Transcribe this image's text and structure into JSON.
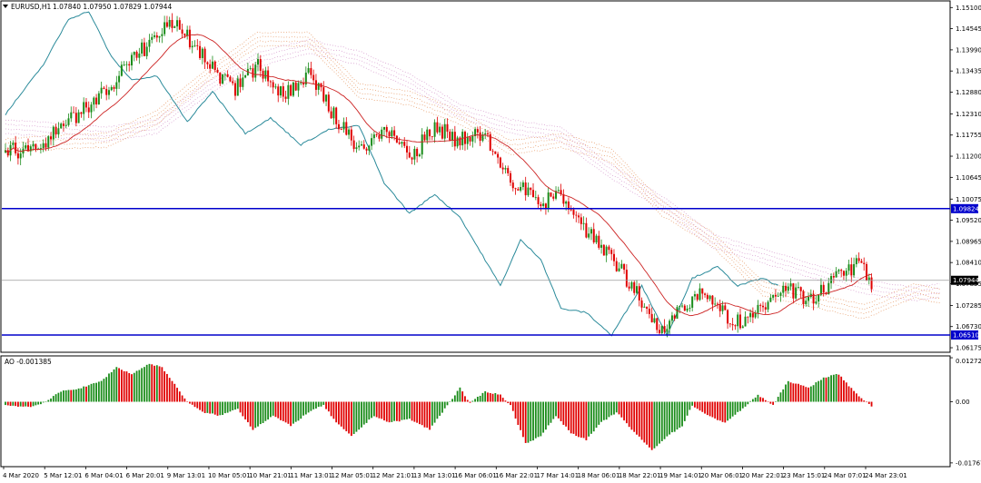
{
  "header": {
    "symbol_label": "EURUSD,H1",
    "ohlc": "1.07840 1.07950 1.07829 1.07944"
  },
  "oscillator": {
    "label": "AO -0.001385"
  },
  "colors": {
    "bull": "#1a8c1a",
    "bear": "#e00000",
    "level_line": "#0000cc",
    "ma": "#cc2222",
    "chikou": "#2a8a9a",
    "cloud_a": "#e8a070",
    "cloud_b": "#d8a0d0",
    "price_tag": "#000000"
  },
  "chart_data": [
    {
      "type": "candlestick",
      "panel": "main",
      "y_ticks": [
        "1.15100",
        "1.14545",
        "1.13990",
        "1.13435",
        "1.12880",
        "1.12310",
        "1.11755",
        "1.11200",
        "1.10645",
        "1.10075",
        "1.09520",
        "1.08965",
        "1.08410",
        "1.07855",
        "1.07285",
        "1.06730",
        "1.06175"
      ],
      "ylim": [
        1.0608,
        1.1525
      ],
      "x_ticks": [
        "4 Mar 2020",
        "5 Mar 12:01",
        "6 Mar 04:01",
        "6 Mar 20:01",
        "9 Mar 13:01",
        "10 Mar 05:01",
        "10 Mar 21:01",
        "11 Mar 13:01",
        "12 Mar 05:01",
        "12 Mar 21:01",
        "13 Mar 13:01",
        "16 Mar 06:01",
        "16 Mar 22:01",
        "17 Mar 14:01",
        "18 Mar 06:01",
        "18 Mar 22:01",
        "19 Mar 14:01",
        "20 Mar 06:01",
        "20 Mar 22:01",
        "23 Mar 15:01",
        "24 Mar 07:01",
        "24 Mar 23:01"
      ],
      "levels": [
        {
          "label": "1.09824",
          "value": 1.09824
        },
        {
          "label": "1.06510",
          "value": 1.0651
        }
      ],
      "current_price": {
        "label": "1.07944",
        "value": 1.07944
      },
      "close_anchors": [
        [
          0,
          1.113
        ],
        [
          12,
          1.1145
        ],
        [
          25,
          1.121
        ],
        [
          40,
          1.1295
        ],
        [
          50,
          1.137
        ],
        [
          58,
          1.1425
        ],
        [
          66,
          1.147
        ],
        [
          72,
          1.143
        ],
        [
          80,
          1.137
        ],
        [
          90,
          1.129
        ],
        [
          100,
          1.136
        ],
        [
          110,
          1.128
        ],
        [
          120,
          1.133
        ],
        [
          130,
          1.123
        ],
        [
          140,
          1.114
        ],
        [
          152,
          1.119
        ],
        [
          160,
          1.111
        ],
        [
          170,
          1.12
        ],
        [
          180,
          1.116
        ],
        [
          190,
          1.118
        ],
        [
          200,
          1.106
        ],
        [
          210,
          1.1
        ],
        [
          220,
          1.101
        ],
        [
          230,
          1.092
        ],
        [
          240,
          1.086
        ],
        [
          250,
          1.076
        ],
        [
          258,
          1.066
        ],
        [
          266,
          1.071
        ],
        [
          275,
          1.077
        ],
        [
          285,
          1.07
        ],
        [
          292,
          1.068
        ],
        [
          300,
          1.072
        ],
        [
          310,
          1.077
        ],
        [
          320,
          1.074
        ],
        [
          330,
          1.081
        ],
        [
          338,
          1.084
        ],
        [
          343,
          1.079
        ]
      ],
      "chikou_anchors": [
        [
          0,
          1.123
        ],
        [
          15,
          1.136
        ],
        [
          25,
          1.148
        ],
        [
          33,
          1.15
        ],
        [
          42,
          1.138
        ],
        [
          50,
          1.132
        ],
        [
          60,
          1.133
        ],
        [
          72,
          1.121
        ],
        [
          82,
          1.129
        ],
        [
          95,
          1.118
        ],
        [
          105,
          1.122
        ],
        [
          117,
          1.115
        ],
        [
          128,
          1.119
        ],
        [
          140,
          1.12
        ],
        [
          150,
          1.105
        ],
        [
          160,
          1.097
        ],
        [
          170,
          1.102
        ],
        [
          180,
          1.096
        ],
        [
          188,
          1.087
        ],
        [
          196,
          1.078
        ],
        [
          204,
          1.09
        ],
        [
          212,
          1.085
        ],
        [
          220,
          1.072
        ],
        [
          230,
          1.071
        ],
        [
          240,
          1.065
        ],
        [
          252,
          1.078
        ],
        [
          262,
          1.065
        ],
        [
          272,
          1.08
        ],
        [
          282,
          1.083
        ],
        [
          290,
          1.078
        ],
        [
          300,
          1.08
        ],
        [
          306,
          1.078
        ]
      ],
      "cloud_a_anchors": [
        [
          0,
          1.1165
        ],
        [
          20,
          1.1175
        ],
        [
          40,
          1.118
        ],
        [
          60,
          1.124
        ],
        [
          80,
          1.135
        ],
        [
          100,
          1.1445
        ],
        [
          120,
          1.1445
        ],
        [
          140,
          1.131
        ],
        [
          160,
          1.129
        ],
        [
          180,
          1.124
        ],
        [
          200,
          1.116
        ],
        [
          220,
          1.118
        ],
        [
          240,
          1.114
        ],
        [
          260,
          1.1
        ],
        [
          280,
          1.092
        ],
        [
          300,
          1.079
        ],
        [
          320,
          1.076
        ],
        [
          340,
          1.073
        ],
        [
          360,
          1.0785
        ],
        [
          370,
          1.077
        ]
      ],
      "cloud_b_anchors": [
        [
          0,
          1.118
        ],
        [
          20,
          1.117
        ],
        [
          40,
          1.116
        ],
        [
          60,
          1.118
        ],
        [
          80,
          1.128
        ],
        [
          100,
          1.1355
        ],
        [
          120,
          1.139
        ],
        [
          140,
          1.136
        ],
        [
          160,
          1.13
        ],
        [
          180,
          1.122
        ],
        [
          200,
          1.118
        ],
        [
          220,
          1.116
        ],
        [
          240,
          1.106
        ],
        [
          260,
          1.098
        ],
        [
          280,
          1.088
        ],
        [
          300,
          1.084
        ],
        [
          320,
          1.08
        ],
        [
          340,
          1.076
        ],
        [
          360,
          1.074
        ],
        [
          370,
          1.075
        ]
      ],
      "candle_count": 344
    },
    {
      "type": "bar",
      "panel": "oscillator",
      "series_label": "AO -0.001385",
      "y_ticks": [
        "0.012728",
        "0.00",
        "-0.017678"
      ],
      "ylim": [
        -0.0185,
        0.013
      ],
      "ao_anchors": [
        [
          0,
          -0.001
        ],
        [
          10,
          -0.0015
        ],
        [
          16,
          0.0
        ],
        [
          22,
          0.003
        ],
        [
          30,
          0.004
        ],
        [
          38,
          0.006
        ],
        [
          44,
          0.01
        ],
        [
          50,
          0.008
        ],
        [
          57,
          0.011
        ],
        [
          62,
          0.01
        ],
        [
          72,
          0.0
        ],
        [
          78,
          -0.003
        ],
        [
          85,
          -0.004
        ],
        [
          92,
          -0.002
        ],
        [
          98,
          -0.008
        ],
        [
          106,
          -0.004
        ],
        [
          113,
          -0.007
        ],
        [
          120,
          -0.003
        ],
        [
          126,
          -0.001
        ],
        [
          131,
          -0.006
        ],
        [
          137,
          -0.01
        ],
        [
          146,
          -0.004
        ],
        [
          152,
          -0.006
        ],
        [
          160,
          -0.005
        ],
        [
          168,
          -0.008
        ],
        [
          174,
          -0.002
        ],
        [
          180,
          0.004
        ],
        [
          184,
          -0.0005
        ],
        [
          190,
          0.003
        ],
        [
          196,
          0.002
        ],
        [
          200,
          -0.001
        ],
        [
          206,
          -0.012
        ],
        [
          212,
          -0.01
        ],
        [
          218,
          -0.004
        ],
        [
          224,
          -0.009
        ],
        [
          230,
          -0.011
        ],
        [
          236,
          -0.006
        ],
        [
          242,
          -0.003
        ],
        [
          248,
          -0.008
        ],
        [
          256,
          -0.014
        ],
        [
          262,
          -0.01
        ],
        [
          268,
          -0.007
        ],
        [
          272,
          -0.001
        ],
        [
          278,
          -0.004
        ],
        [
          285,
          -0.006
        ],
        [
          292,
          -0.002
        ],
        [
          298,
          0.002
        ],
        [
          304,
          -0.001
        ],
        [
          310,
          0.006
        ],
        [
          318,
          0.004
        ],
        [
          324,
          0.007
        ],
        [
          330,
          0.008
        ],
        [
          336,
          0.003
        ],
        [
          343,
          -0.0014
        ]
      ]
    }
  ]
}
